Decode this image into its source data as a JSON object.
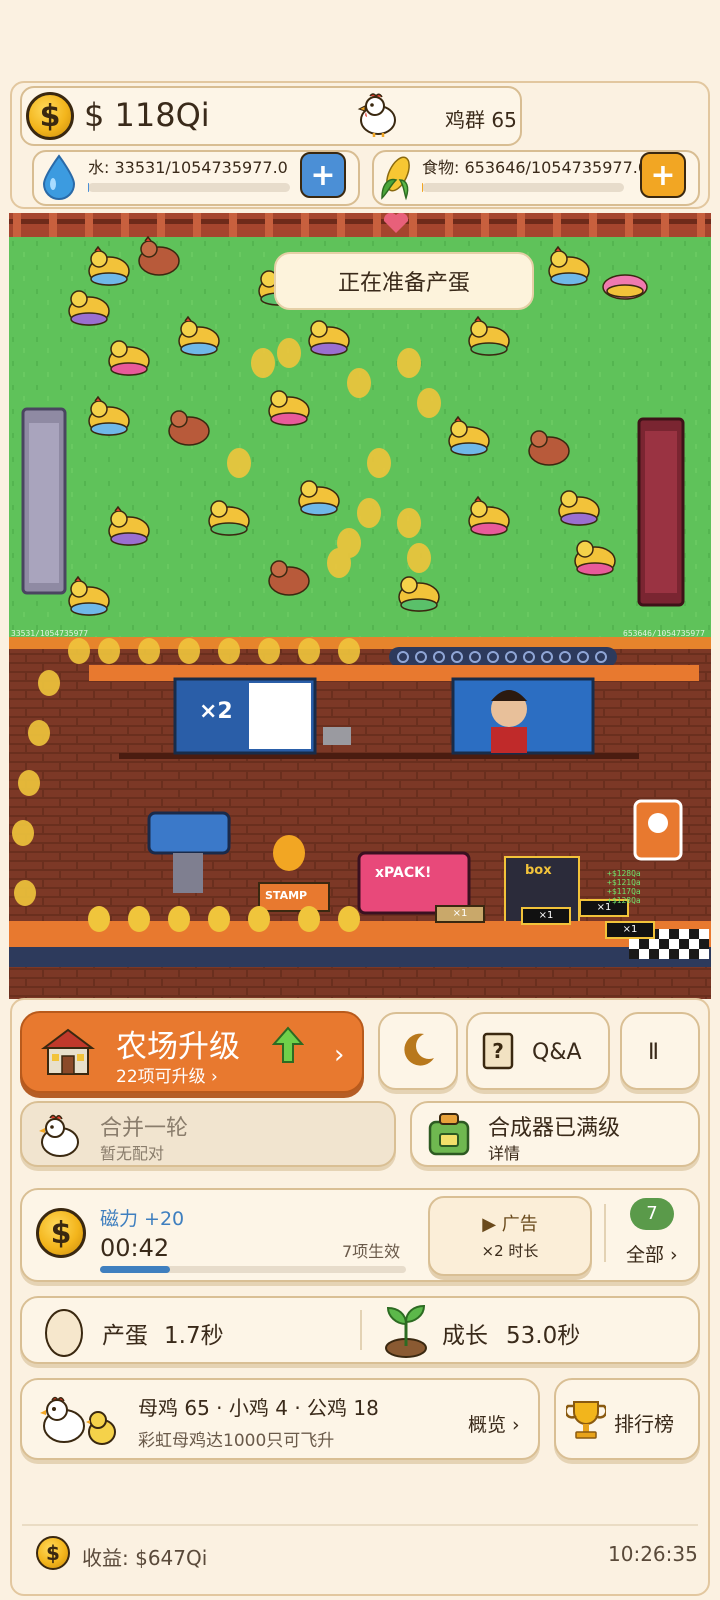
{
  "hud": {
    "money": "$ 118Qi",
    "flock_label": "鸡群 65",
    "water_label": "水: 33531/1054735977.0",
    "water_fill": 3e-05,
    "food_label": "食物: 653646/1054735977.0",
    "food_fill": 0.0006,
    "plus_label": "+"
  },
  "scene": {
    "status": "正在准备产蛋",
    "water_readout": "33531/1054735977",
    "food_readout": "653646/1054735977",
    "screen_label": "×2",
    "pack_label": "xPACK!",
    "box_label": "box",
    "stamp_label": "STAMP",
    "multiplier": "×1",
    "floating_values": [
      "+$128Qa",
      "+$121Qa",
      "+$117Qa",
      "+$128Qa"
    ]
  },
  "controls": {
    "farm_upgrade_title": "农场升级",
    "farm_upgrade_sub": "22项可升级 ›",
    "farm_upgrade_arrow": "›",
    "qa_label": "Q&A",
    "pause_label": "II",
    "merge_title": "合并一轮",
    "merge_sub": "暂无配对",
    "synth_title": "合成器已满级",
    "synth_sub": "详情",
    "magnet_title": "磁力 +20",
    "magnet_timer": "00:42",
    "magnet_progress": 0.23,
    "effects_label": "7项生效",
    "ad_title": "▶ 广告",
    "ad_sub": "×2 时长",
    "count_badge": "7",
    "all_label": "全部 ›",
    "egg_label": "产蛋",
    "egg_value": "1.7秒",
    "grow_label": "成长",
    "grow_value": "53.0秒",
    "flock_summary": "母鸡 65 · 小鸡 4 · 公鸡 18",
    "flock_hint": "彩虹母鸡达1000只可飞升",
    "overview_label": "概览 ›",
    "rank_label": "排行榜"
  },
  "footer": {
    "earnings": "收益: $647Qi",
    "time": "10:26:35"
  },
  "colors": {
    "accent_orange": "#e8792f",
    "water_blue": "#4b8fd6",
    "food_orange": "#f2a623",
    "progress_blue": "#3f7fbf",
    "badge_green": "#5a9a4a"
  }
}
